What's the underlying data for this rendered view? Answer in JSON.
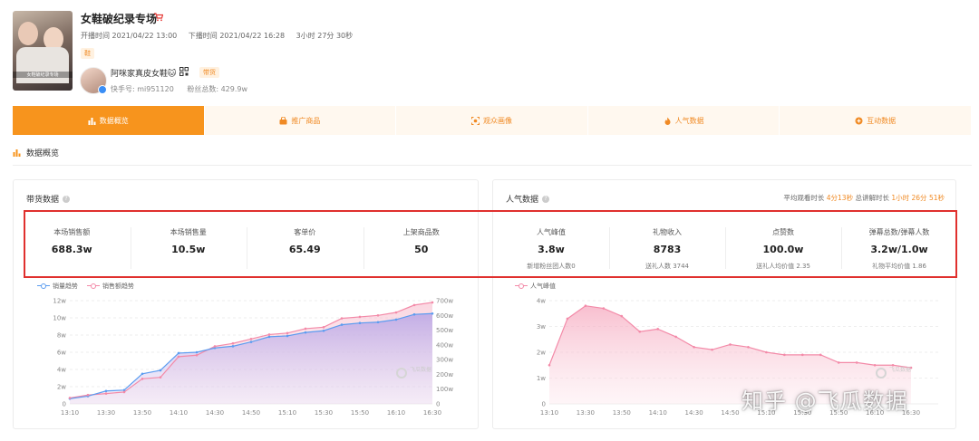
{
  "header": {
    "title": "女鞋破纪录专场",
    "start_time": "开播时间 2021/04/22 13:00",
    "end_time": "下播时间 2021/04/22 16:28",
    "duration": "3小时 27分 30秒",
    "category_tag": "鞋",
    "cover_caption": "女鞋破纪录专场",
    "anchor_name": "阿咪家真皮女鞋🐱",
    "anchor_badge": "带货",
    "kuaishou_id": "快手号: mi951120",
    "fans": "粉丝总数: 429.9w"
  },
  "tabs": [
    {
      "label": "数据概览",
      "icon": "bar-chart-icon",
      "active": true
    },
    {
      "label": "推广商品",
      "icon": "shopping-bag-icon",
      "active": false
    },
    {
      "label": "观众画像",
      "icon": "portrait-icon",
      "active": false
    },
    {
      "label": "人气数据",
      "icon": "flame-icon",
      "active": false
    },
    {
      "label": "互动数据",
      "icon": "interaction-icon",
      "active": false
    }
  ],
  "section_title": "数据概览",
  "sales_panel": {
    "title": "带货数据",
    "metrics": [
      {
        "label": "本场销售额",
        "value": "688.3w"
      },
      {
        "label": "本场销售量",
        "value": "10.5w"
      },
      {
        "label": "客单价",
        "value": "65.49"
      },
      {
        "label": "上架商品数",
        "value": "50"
      }
    ],
    "legend": [
      "销量趋势",
      "销售额趋势"
    ],
    "watermark": "飞瓜数据"
  },
  "popularity_panel": {
    "title": "人气数据",
    "watch_label": "平均观看时长",
    "watch_value": "4分13秒",
    "explain_label": "总讲解时长",
    "explain_value": "1小时 26分 51秒",
    "metrics": [
      {
        "label": "人气峰值",
        "value": "3.8w",
        "sub": "新增粉丝团人数0"
      },
      {
        "label": "礼物收入",
        "value": "8783",
        "sub": "送礼人数 3744"
      },
      {
        "label": "点赞数",
        "value": "100.0w",
        "sub": "送礼人均价值 2.35"
      },
      {
        "label": "弹幕总数/弹幕人数",
        "value": "3.2w/1.0w",
        "sub": "礼物平均价值 1.86"
      }
    ],
    "legend": [
      "人气峰值"
    ],
    "watermark": "飞瓜数据"
  },
  "zhihu_watermark": "知乎 @飞瓜数据",
  "colors": {
    "accent": "#f7941d",
    "volume_line": "#5b9cf0",
    "sales_line": "#f38aa8",
    "alert_box": "#e0302e"
  },
  "chart_data": [
    {
      "type": "line",
      "title": "",
      "x": [
        "13:10",
        "13:20",
        "13:30",
        "13:40",
        "13:50",
        "14:00",
        "14:10",
        "14:20",
        "14:30",
        "14:40",
        "14:50",
        "15:00",
        "15:10",
        "15:20",
        "15:30",
        "15:40",
        "15:50",
        "16:00",
        "16:10",
        "16:20",
        "16:30"
      ],
      "x_ticks": [
        "13:10",
        "13:30",
        "13:50",
        "14:10",
        "14:30",
        "14:50",
        "15:10",
        "15:30",
        "15:50",
        "16:10",
        "16:30"
      ],
      "series": [
        {
          "name": "销量趋势",
          "axis": "left",
          "values": [
            0.6,
            0.9,
            1.5,
            1.6,
            3.5,
            3.9,
            5.9,
            6.0,
            6.5,
            6.7,
            7.2,
            7.8,
            7.9,
            8.3,
            8.5,
            9.2,
            9.4,
            9.5,
            9.8,
            10.4,
            10.5
          ]
        },
        {
          "name": "销售额趋势",
          "axis": "right",
          "values": [
            40,
            60,
            70,
            80,
            170,
            180,
            320,
            330,
            390,
            410,
            440,
            470,
            480,
            510,
            520,
            580,
            590,
            600,
            620,
            670,
            688
          ]
        }
      ],
      "y_left": {
        "ticks": [
          "0",
          "2w",
          "4w",
          "6w",
          "8w",
          "10w",
          "12w"
        ],
        "ylim": [
          0,
          12
        ]
      },
      "y_right": {
        "ticks": [
          "0",
          "100w",
          "200w",
          "300w",
          "400w",
          "500w",
          "600w",
          "700w"
        ],
        "ylim": [
          0,
          700
        ]
      }
    },
    {
      "type": "area",
      "title": "",
      "x": [
        "13:10",
        "13:20",
        "13:30",
        "13:40",
        "13:50",
        "14:00",
        "14:10",
        "14:20",
        "14:30",
        "14:40",
        "14:50",
        "15:00",
        "15:10",
        "15:20",
        "15:30",
        "15:40",
        "15:50",
        "16:00",
        "16:10",
        "16:20",
        "16:30"
      ],
      "x_ticks": [
        "13:10",
        "13:30",
        "13:50",
        "14:10",
        "14:30",
        "14:50",
        "15:10",
        "15:30",
        "15:50",
        "16:10",
        "16:30"
      ],
      "series": [
        {
          "name": "人气峰值",
          "values": [
            1.5,
            3.3,
            3.8,
            3.7,
            3.4,
            2.8,
            2.9,
            2.6,
            2.2,
            2.1,
            2.3,
            2.2,
            2.0,
            1.9,
            1.9,
            1.9,
            1.6,
            1.6,
            1.5,
            1.5,
            1.4
          ]
        }
      ],
      "y": {
        "ticks": [
          "0",
          "1w",
          "2w",
          "3w",
          "4w"
        ],
        "ylim": [
          0,
          4
        ]
      }
    }
  ]
}
